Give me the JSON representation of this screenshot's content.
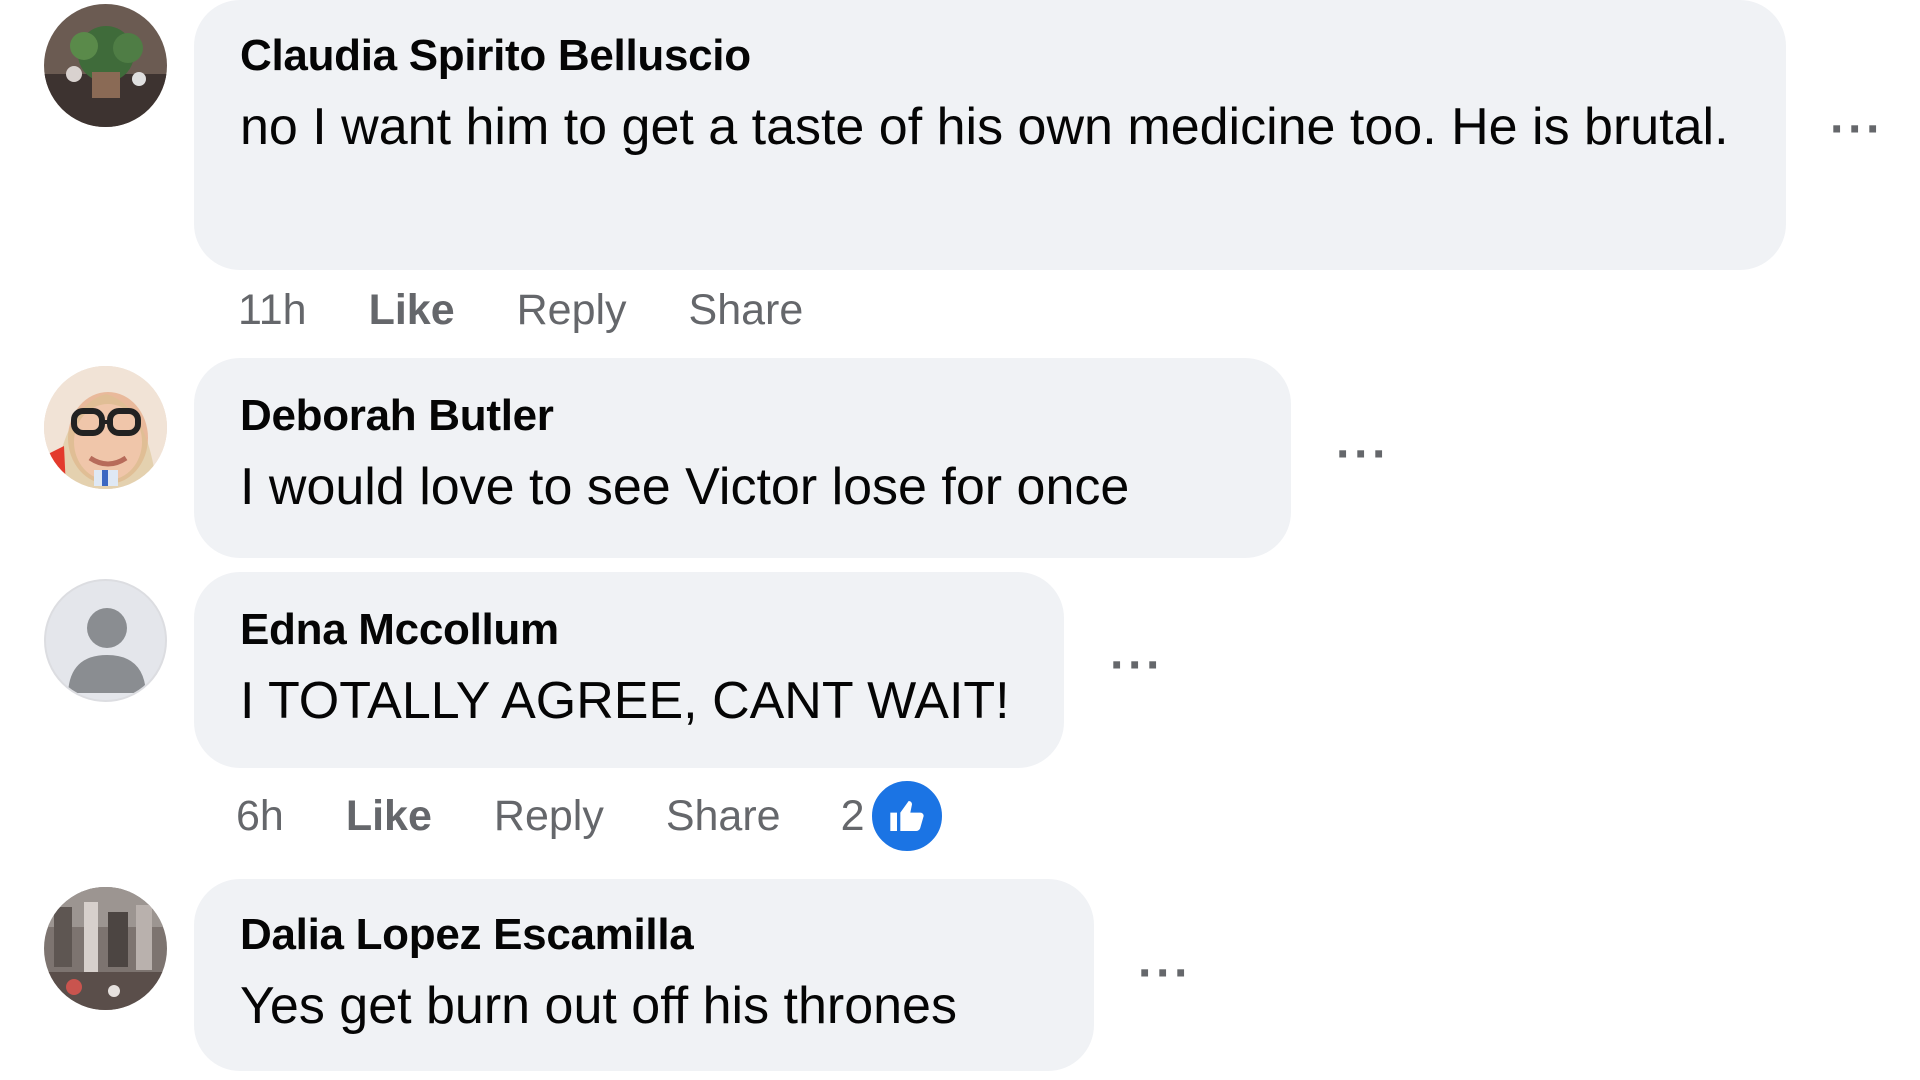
{
  "comments": [
    {
      "author": "Claudia Spirito Belluscio",
      "text": "no I want him to get a taste of his own medicine too. He is brutal.",
      "time": "11h",
      "like": "Like",
      "reply": "Reply",
      "share": "Share",
      "more": "···"
    },
    {
      "author": "Deborah Butler",
      "text": "I would love to see Victor lose for once",
      "more": "···"
    },
    {
      "author": "Edna Mccollum",
      "text": "I TOTALLY AGREE, CANT WAIT!",
      "time": "6h",
      "like": "Like",
      "reply": "Reply",
      "share": "Share",
      "reaction_count": "2",
      "more": "···"
    },
    {
      "author": "Dalia Lopez Escamilla",
      "text": "Yes get burn out off his thrones",
      "more": "···"
    }
  ],
  "colors": {
    "bubble": "#f0f2f5",
    "secondary_text": "#65676b",
    "like_blue": "#1b74e4"
  }
}
